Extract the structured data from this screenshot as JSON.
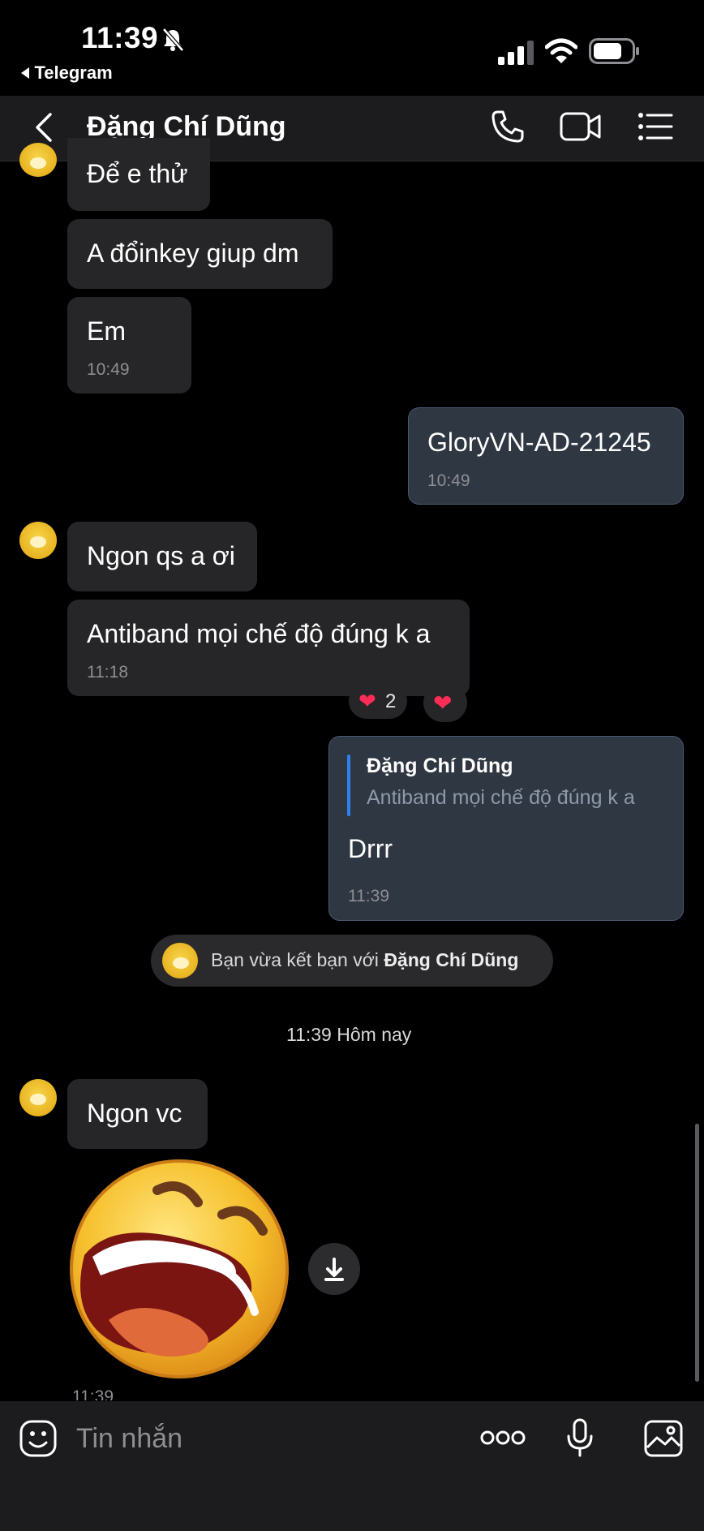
{
  "status_bar": {
    "time": "11:39",
    "back_app": "Telegram"
  },
  "header": {
    "title": "Đặng Chí Dũng"
  },
  "messages": [
    {
      "text": "Để e thử"
    },
    {
      "text": "A đổinkey giup dm"
    },
    {
      "text": "Em",
      "time": "10:49"
    },
    {
      "text": "GloryVN-AD-21245",
      "time": "10:49"
    },
    {
      "text": "Ngon qs a ơi"
    },
    {
      "text": "Antiband mọi chế độ đúng k a",
      "time": "11:18"
    },
    {
      "reply_name": "Đặng Chí Dũng",
      "reply_text": "Antiband mọi chế độ đúng k a",
      "text": "Drrr",
      "time": "11:39"
    },
    {
      "text": "Ngon vc"
    }
  ],
  "reactions": {
    "heart_count": "2"
  },
  "system": {
    "prefix": "Bạn vừa kết bạn với",
    "name": "Đặng Chí Dũng"
  },
  "date_label": "11:39 Hôm nay",
  "sticker_time": "11:39",
  "input": {
    "placeholder": "Tin nhắn"
  },
  "colors": {
    "background": "#000000",
    "incoming_bubble": "#262628",
    "outgoing_bubble": "#2f3743",
    "accent": "#2f80ed"
  }
}
